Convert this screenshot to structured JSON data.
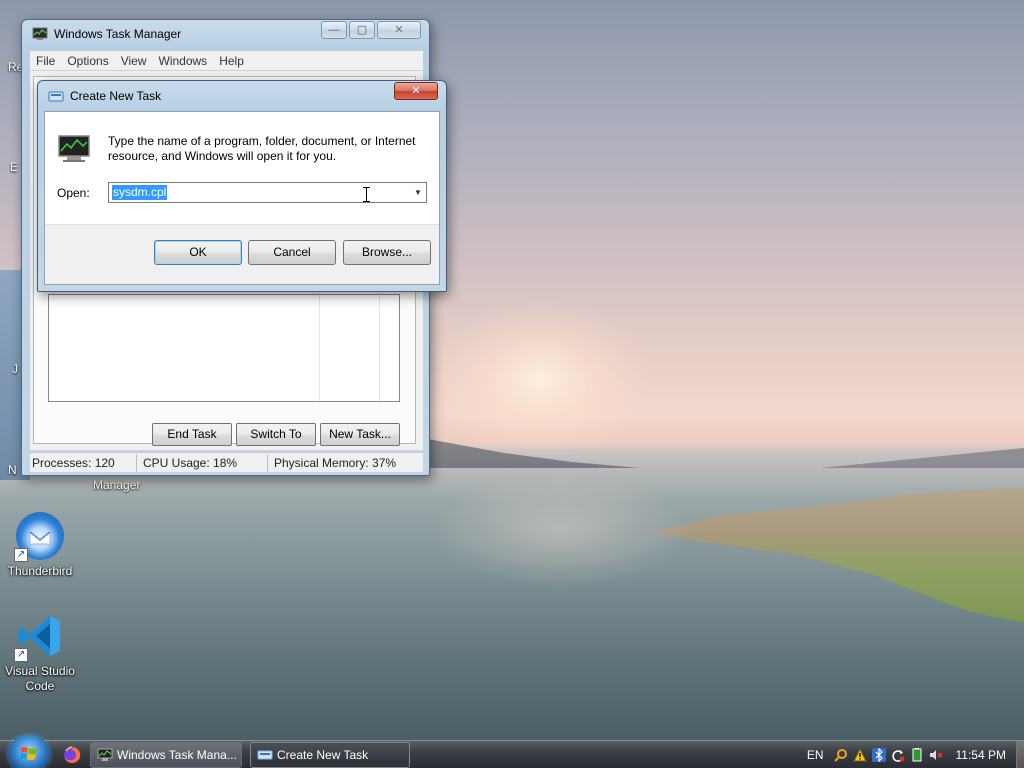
{
  "desktop": {
    "icons": [
      {
        "label": "Thunderbird"
      },
      {
        "label": "Visual Studio Code"
      }
    ],
    "partial_labels": [
      "Re",
      "E",
      "J",
      "N"
    ],
    "taskmgr_icon_label": "Manager"
  },
  "task_manager": {
    "title": "Windows Task Manager",
    "menu": [
      "File",
      "Options",
      "View",
      "Windows",
      "Help"
    ],
    "buttons": {
      "end_task": "End Task",
      "switch_to": "Switch To",
      "new_task": "New Task..."
    },
    "status": {
      "processes": "Processes: 120",
      "cpu": "CPU Usage: 18%",
      "memory": "Physical Memory: 37%"
    }
  },
  "create_task_dialog": {
    "title": "Create New Task",
    "message": "Type the name of a program, folder, document, or Internet resource, and Windows will open it for you.",
    "open_label": "Open:",
    "open_value": "sysdm.cpl",
    "buttons": {
      "ok": "OK",
      "cancel": "Cancel",
      "browse": "Browse..."
    }
  },
  "taskbar": {
    "tasks": [
      {
        "label": "Windows Task Mana...",
        "active": false
      },
      {
        "label": "Create New Task",
        "active": true
      }
    ],
    "tray": {
      "language": "EN",
      "icons": [
        "search-icon",
        "warning-icon",
        "bluetooth-icon",
        "sync-icon",
        "battery-icon",
        "volume-muted-icon"
      ],
      "clock": "11:54 PM"
    }
  },
  "colors": {
    "selection": "#3399ff",
    "close_button": "#c4422a",
    "window_frame": "#b7cee3"
  }
}
